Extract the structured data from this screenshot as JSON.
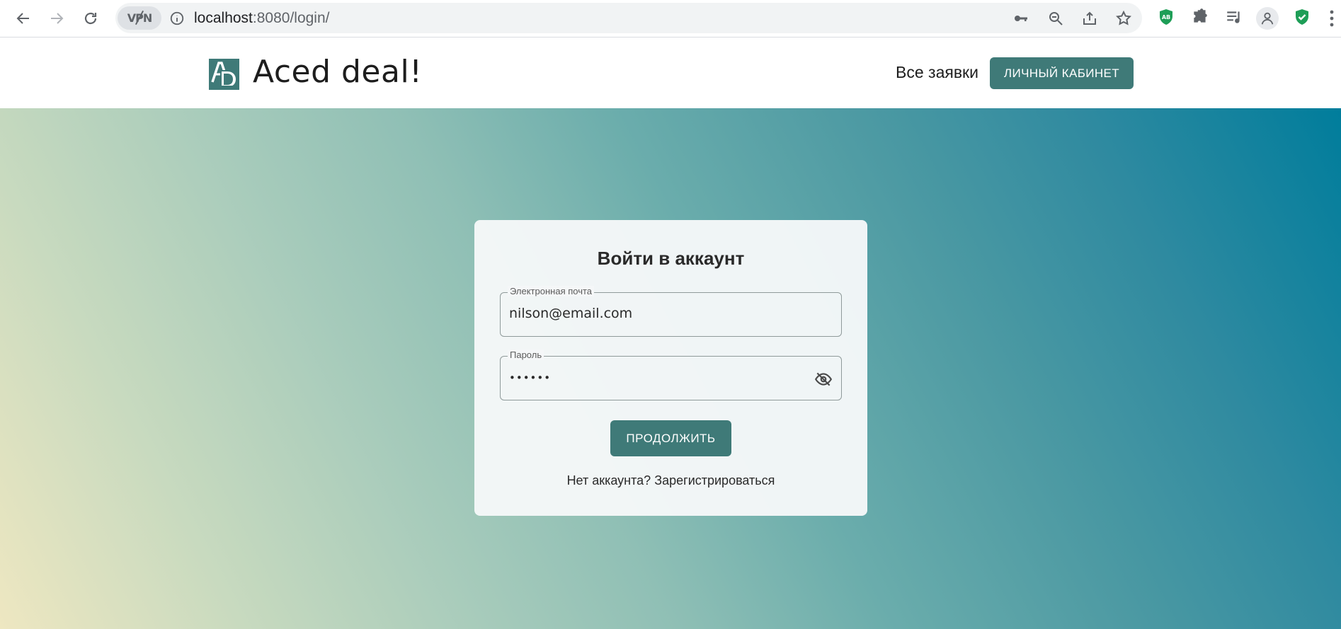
{
  "browser": {
    "vpn_label": "VPN",
    "url_host": "localhost",
    "url_rest": ":8080/login/"
  },
  "header": {
    "brand": "Aced deal!",
    "nav_all_requests": "Все заявки",
    "cabinet_button": "ЛИЧНЫЙ КАБИНЕТ",
    "accent_color": "#3f7a78"
  },
  "login": {
    "title": "Войти в аккаунт",
    "email_label": "Электронная почта",
    "email_value": "nilson@email.com",
    "password_label": "Пароль",
    "password_value": "••••••",
    "continue_button": "ПРОДОЛЖИТЬ",
    "no_account_text": "Нет аккаунта?",
    "register_link": "Зарегистрироваться"
  },
  "icons": {
    "back": "arrow-left",
    "forward": "arrow-right",
    "reload": "reload",
    "info": "info-circle",
    "key": "key",
    "zoom": "zoom-out",
    "share": "share",
    "bookmark": "star",
    "adblock": "adblock-shield",
    "extensions": "puzzle",
    "media": "media-queue",
    "profile": "person",
    "security": "shield-check",
    "menu": "vertical-dots",
    "password_visibility": "eye-slash"
  }
}
